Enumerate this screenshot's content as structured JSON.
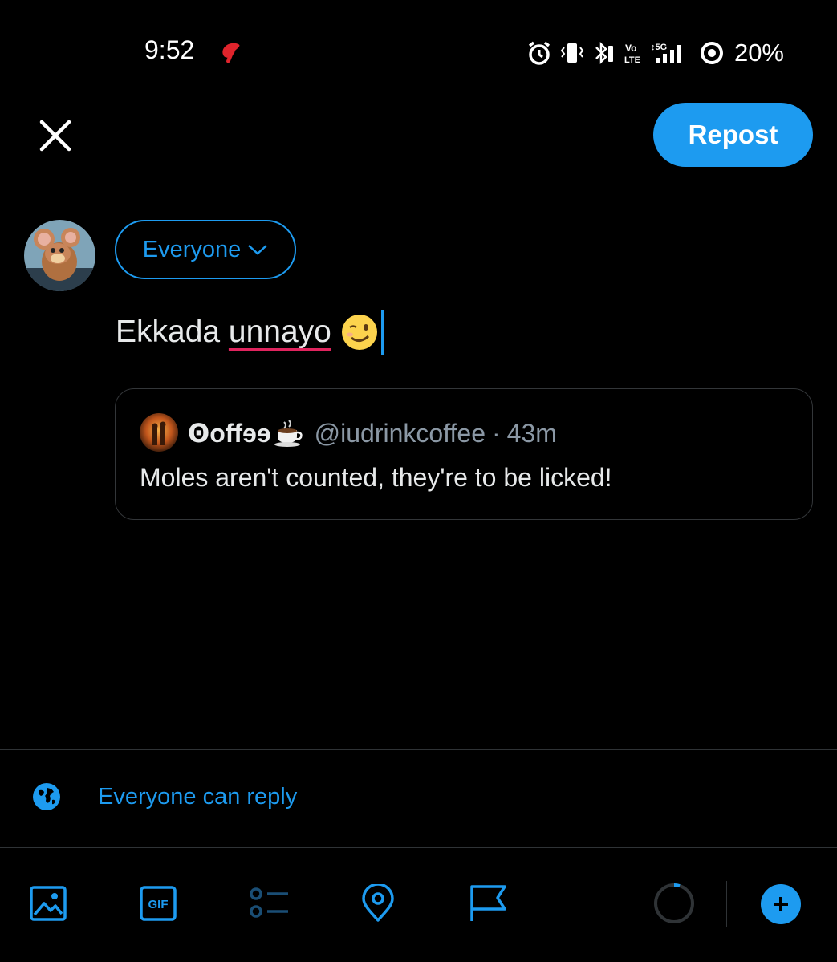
{
  "status_bar": {
    "time": "9:52",
    "battery_percent": "20%",
    "network": "5G",
    "volte": "Vo LTE"
  },
  "header": {
    "close_icon": "close-icon",
    "repost_label": "Repost"
  },
  "composer": {
    "audience_label": "Everyone",
    "text_before": "Ekkada ",
    "text_misspelled": "unnayo",
    "emoji": "winking-face"
  },
  "quoted_post": {
    "display_name": "Ꙩoffɘɘ",
    "handle": "@iudrinkcoffee",
    "separator": "·",
    "time_ago": "43m",
    "text": "Moles aren't counted, they're to be licked!"
  },
  "reply_setting": {
    "label": "Everyone can reply",
    "icon": "globe-icon"
  },
  "toolbar": {
    "items": [
      "image-icon",
      "gif-icon",
      "poll-icon",
      "location-icon",
      "flag-icon"
    ],
    "gif_text": "GIF"
  },
  "colors": {
    "accent": "#1d9bf0",
    "background": "#000000",
    "text": "#e7e9ea",
    "muted": "#8b98a5",
    "border": "#2f3336",
    "misspell": "#e0245e"
  }
}
